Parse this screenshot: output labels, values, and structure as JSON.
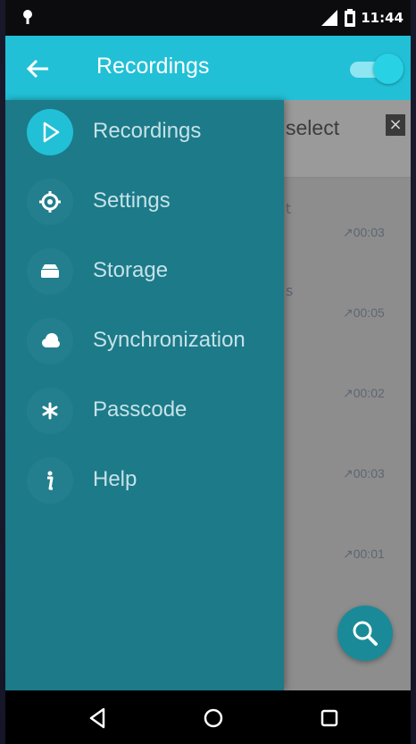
{
  "status": {
    "time": "11:44"
  },
  "appbar": {
    "title": "Recordings"
  },
  "background": {
    "select_label": "select",
    "close_label": "×",
    "times": [
      "↗00:03",
      "↗00:05",
      "↗00:02",
      "↗00:03",
      "↗00:01"
    ]
  },
  "drawer": {
    "items": [
      {
        "label": "Recordings",
        "icon": "play-icon",
        "active": true
      },
      {
        "label": "Settings",
        "icon": "gear-icon",
        "active": false
      },
      {
        "label": "Storage",
        "icon": "storage-icon",
        "active": false
      },
      {
        "label": "Synchronization",
        "icon": "cloud-icon",
        "active": false
      },
      {
        "label": "Passcode",
        "icon": "asterisk-icon",
        "active": false
      },
      {
        "label": "Help",
        "icon": "info-icon",
        "active": false
      }
    ]
  },
  "colors": {
    "accent": "#22c0d6",
    "drawer": "#1c7a89",
    "fab": "#1a8a98"
  }
}
